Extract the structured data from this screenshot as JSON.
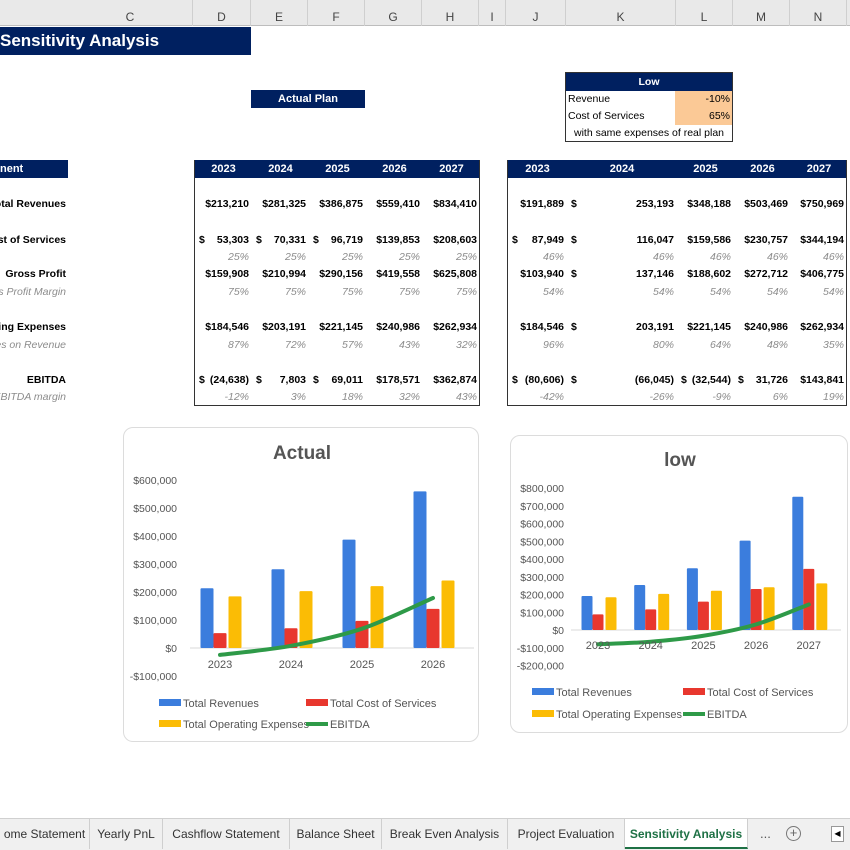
{
  "columns": [
    "C",
    "D",
    "E",
    "F",
    "G",
    "H",
    "I",
    "J",
    "K",
    "L",
    "M",
    "N"
  ],
  "title": "Sensitivity Analysis",
  "actual_plan_label": "Actual Plan",
  "low_box": {
    "header": "Low",
    "rows": [
      {
        "label": "Revenue",
        "value": "-10%"
      },
      {
        "label": "Cost of Services",
        "value": "65%"
      }
    ],
    "note": "with same expenses of real plan",
    "highlight_color": "#fbc996"
  },
  "left_header_label": "nent",
  "years": [
    "2023",
    "2024",
    "2025",
    "2026",
    "2027"
  ],
  "row_labels": [
    {
      "text": "otal Revenues",
      "style": "b"
    },
    {
      "text": "ost of Services",
      "style": "b"
    },
    {
      "text": "",
      "style": "p"
    },
    {
      "text": "Gross Profit",
      "style": "b"
    },
    {
      "text": "s Profit Margin",
      "style": "p"
    },
    {
      "text": "ating Expenses",
      "style": "b"
    },
    {
      "text": "es on Revenue",
      "style": "p"
    },
    {
      "text": "EBITDA",
      "style": "b"
    },
    {
      "text": "EBITDA margin",
      "style": "p"
    }
  ],
  "actual_table": [
    [
      "$213,210",
      "$281,325",
      "$386,875",
      "$559,410",
      "$834,410"
    ],
    [
      "$ 53,303",
      "$ 70,331",
      "$ 96,719",
      "$139,853",
      "$208,603"
    ],
    [
      "25%",
      "25%",
      "25%",
      "25%",
      "25%"
    ],
    [
      "$159,908",
      "$210,994",
      "$290,156",
      "$419,558",
      "$625,808"
    ],
    [
      "75%",
      "75%",
      "75%",
      "75%",
      "75%"
    ],
    [
      "$184,546",
      "$203,191",
      "$221,145",
      "$240,986",
      "$262,934"
    ],
    [
      "87%",
      "72%",
      "57%",
      "43%",
      "32%"
    ],
    [
      "$ (24,638)",
      "$ 7,803",
      "$ 69,011",
      "$178,571",
      "$362,874"
    ],
    [
      "-12%",
      "3%",
      "18%",
      "32%",
      "43%"
    ]
  ],
  "low_table": [
    [
      "$191,889",
      "$ 253,193",
      "$348,188",
      "$503,469",
      "$750,969"
    ],
    [
      "$ 87,949",
      "$ 116,047",
      "$159,586",
      "$230,757",
      "$344,194"
    ],
    [
      "46%",
      "46%",
      "46%",
      "46%",
      "46%"
    ],
    [
      "$103,940",
      "$ 137,146",
      "$188,602",
      "$272,712",
      "$406,775"
    ],
    [
      "54%",
      "54%",
      "54%",
      "54%",
      "54%"
    ],
    [
      "$184,546",
      "$ 203,191",
      "$221,145",
      "$240,986",
      "$262,934"
    ],
    [
      "96%",
      "80%",
      "64%",
      "48%",
      "35%"
    ],
    [
      "$ (80,606)",
      "$ (66,045)",
      "$ (32,544)",
      "$ 31,726",
      "$143,841"
    ],
    [
      "-42%",
      "-26%",
      "-9%",
      "6%",
      "19%"
    ]
  ],
  "chart_data": [
    {
      "type": "bar",
      "title": "Actual",
      "categories": [
        "2023",
        "2024",
        "2025",
        "2026"
      ],
      "ylim": [
        -100000,
        600000
      ],
      "yticks": [
        "$600,000",
        "$500,000",
        "$400,000",
        "$300,000",
        "$200,000",
        "$100,000",
        "$0",
        "-$100,000"
      ],
      "grid": false,
      "legend": "bottom",
      "series": [
        {
          "name": "Total Revenues",
          "kind": "bar",
          "color": "#3b7ddd",
          "values": [
            213210,
            281325,
            386875,
            559410
          ]
        },
        {
          "name": "Total Cost of Services",
          "kind": "bar",
          "color": "#e8372e",
          "values": [
            53303,
            70331,
            96719,
            139853
          ]
        },
        {
          "name": "Total Operating Expenses",
          "kind": "bar",
          "color": "#fbbc05",
          "values": [
            184546,
            203191,
            221145,
            240986
          ]
        },
        {
          "name": "EBITDA",
          "kind": "line",
          "color": "#2e9a48",
          "values": [
            -24638,
            7803,
            69011,
            178571
          ]
        }
      ]
    },
    {
      "type": "bar",
      "title": "low",
      "categories": [
        "2023",
        "2024",
        "2025",
        "2026",
        "2027"
      ],
      "ylim": [
        -200000,
        800000
      ],
      "yticks": [
        "$800,000",
        "$700,000",
        "$600,000",
        "$500,000",
        "$400,000",
        "$300,000",
        "$200,000",
        "$100,000",
        "$0",
        "-$100,000",
        "-$200,000"
      ],
      "grid": false,
      "legend": "bottom",
      "series": [
        {
          "name": "Total Revenues",
          "kind": "bar",
          "color": "#3b7ddd",
          "values": [
            191889,
            253193,
            348188,
            503469,
            750969
          ]
        },
        {
          "name": "Total Cost of Services",
          "kind": "bar",
          "color": "#e8372e",
          "values": [
            87949,
            116047,
            159586,
            230757,
            344194
          ]
        },
        {
          "name": "Total Operating Expenses",
          "kind": "bar",
          "color": "#fbbc05",
          "values": [
            184546,
            203191,
            221145,
            240986,
            262934
          ]
        },
        {
          "name": "EBITDA",
          "kind": "line",
          "color": "#2e9a48",
          "values": [
            -80606,
            -66045,
            -32544,
            31726,
            143841
          ]
        }
      ]
    }
  ],
  "sheet_tabs": [
    {
      "label": "ome Statement",
      "active": false
    },
    {
      "label": "Yearly PnL",
      "active": false
    },
    {
      "label": "Cashflow Statement",
      "active": false
    },
    {
      "label": "Balance Sheet",
      "active": false
    },
    {
      "label": "Break Even Analysis",
      "active": false
    },
    {
      "label": "Project Evaluation",
      "active": false
    },
    {
      "label": "Sensitivity Analysis",
      "active": true
    }
  ],
  "tab_more": "...",
  "add_sheet_icon": "plus-circle-icon",
  "scroll_left_icon": "triangle-left-icon"
}
